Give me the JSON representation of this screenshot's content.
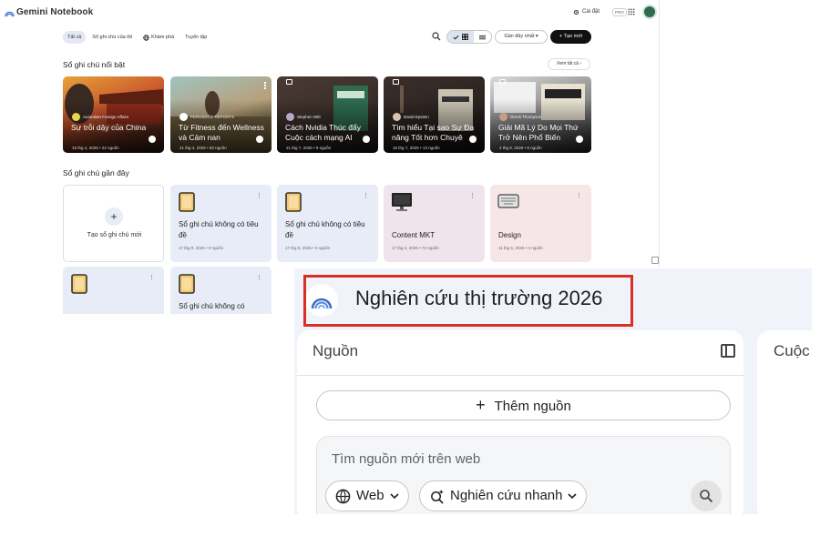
{
  "app": {
    "title": "Gemini Notebook",
    "settings_label": "Cài đặt",
    "pro_label": "PRO"
  },
  "filters": {
    "all": "Tất cả",
    "mine": "Sổ ghi chú của tôi",
    "explore": "Khám phá",
    "collections": "Tuyển tập"
  },
  "toolbar": {
    "sort_label": "Gần đây nhất",
    "create_label": "Tạo mới"
  },
  "featured": {
    "heading": "Sổ ghi chú nổi bật",
    "see_all": "Xem tất cả",
    "items": [
      {
        "source": "Australian Foreign Affairs",
        "title": "Sự trỗi dậy của China",
        "meta": "15 thg 4, 2026 • 22 nguồn"
      },
      {
        "source": "PERIODICO REPORTS",
        "title": "Từ Fitness đến Wellness và Cảm nan",
        "meta": "21 thg 4, 2026 • 50 nguồn"
      },
      {
        "source": "Stephen Witt",
        "title": "Cách Nvidia Thúc đẩy Cuộc cách mạng AI",
        "meta": "21 thg 7, 2026 • 9 nguồn"
      },
      {
        "source": "David Epstein",
        "title": "Tìm hiểu Tại sao Sự Đa năng Tốt hơn Chuyê",
        "meta": "15 thg 7, 2026 • 13 nguồn"
      },
      {
        "source": "Derek Thompson",
        "title": "Giải Mã Lý Do Mọi Thứ Trở Nên Phổ Biến",
        "meta": "4 thg 8, 2026 • 8 nguồn"
      }
    ]
  },
  "recent": {
    "heading": "Sổ ghi chú gần đây",
    "new_label": "Tạo sổ ghi chú mới",
    "items": [
      {
        "title": "Sổ ghi chú không có tiêu đề",
        "meta": "17 thg 9, 2026 • 0 nguồn"
      },
      {
        "title": "Sổ ghi chú không có tiêu đề",
        "meta": "17 thg 9, 2026 • 0 nguồn"
      },
      {
        "title": "Content MKT",
        "meta": "17 thg 4, 2026 • 72 nguồn"
      },
      {
        "title": "Design",
        "meta": "11 thg 5, 2026 • 4 nguồn"
      },
      {
        "title": "",
        "meta": ""
      },
      {
        "title": "Sổ ghi chú không có",
        "meta": ""
      }
    ]
  },
  "zoom": {
    "notebook_title": "Nghiên cứu thị trường 2026",
    "sources_heading": "Nguồn",
    "add_source": "Thêm nguồn",
    "web_search_placeholder": "Tìm nguồn mới trên web",
    "web_option": "Web",
    "research_option": "Nghiên cứu nhanh",
    "chat_heading": "Cuộc"
  },
  "colors": {
    "accent": "#111111",
    "highlight_border": "#d93025",
    "card_blue": "#e8ecf7",
    "card_mauve": "#efe4ec",
    "card_pink": "#f7e6e8"
  }
}
